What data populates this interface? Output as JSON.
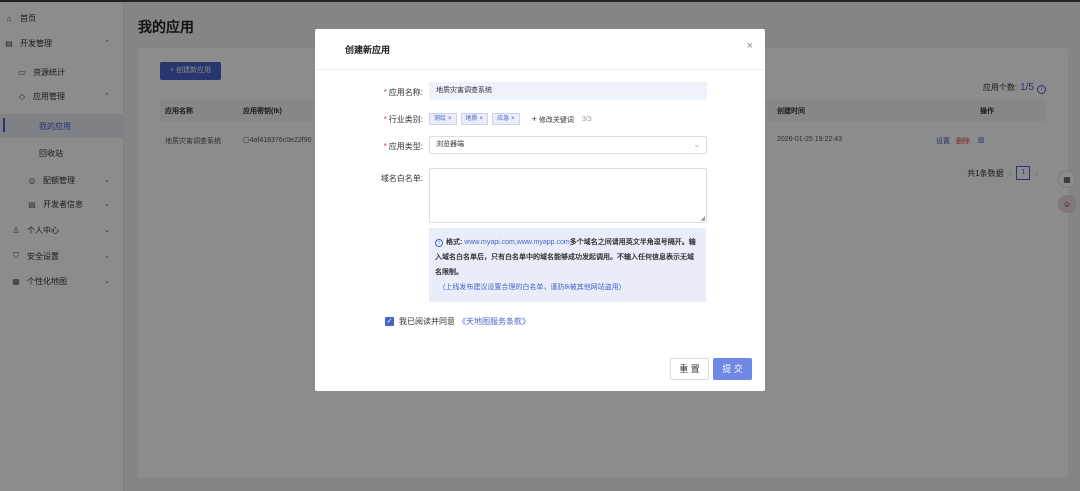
{
  "sidebar": {
    "items": [
      {
        "label": "首页",
        "icon": "home-icon",
        "glyph": "⌂"
      },
      {
        "label": "开发管理",
        "icon": "document-icon",
        "glyph": "▤",
        "chevron": "⌃"
      },
      {
        "label": "资源统计",
        "icon": "monitor-icon",
        "glyph": "▭"
      },
      {
        "label": "应用管理",
        "icon": "apps-icon",
        "glyph": "◇",
        "chevron": "⌃"
      },
      {
        "label": "我的应用"
      },
      {
        "label": "回收站"
      },
      {
        "label": "配额管理",
        "icon": "quota-icon",
        "glyph": "◎",
        "chevron": "⌄"
      },
      {
        "label": "开发者信息",
        "icon": "developer-icon",
        "glyph": "▤",
        "chevron": "⌄"
      },
      {
        "label": "个人中心",
        "icon": "user-icon",
        "glyph": "♙",
        "chevron": "⌄"
      },
      {
        "label": "安全设置",
        "icon": "shield-icon",
        "glyph": "⛉",
        "chevron": "⌄"
      },
      {
        "label": "个性化地图",
        "icon": "map-grid-icon",
        "glyph": "▦",
        "chevron": "⌄"
      }
    ]
  },
  "main": {
    "title": "我的应用",
    "create_button": "+ 创建新应用",
    "app_count_label": "应用个数:",
    "app_count_value": "1/5",
    "columns": {
      "name": "应用名称",
      "key": "应用密钥(tk)",
      "created": "创建时间",
      "ops": "操作"
    },
    "row": {
      "name": "地质灾害调查系统",
      "key": "▢4af418376c0e22f90",
      "created": "2026-01-25 19:22:43",
      "op_settings": "设置",
      "op_delete": "删除",
      "op_stats": "▥"
    },
    "pager": {
      "total": "共1条数据",
      "prev": "‹",
      "page": "1",
      "next": "›"
    }
  },
  "modal": {
    "title": "创建新应用",
    "close": "×",
    "name_label": "应用名称:",
    "name_value": "地质灾害调查系统",
    "industry_label": "行业类别:",
    "tags": [
      "测绘",
      "地质",
      "应急"
    ],
    "modify_button": "修改关键词",
    "tag_count": "3/3",
    "type_label": "应用类型:",
    "type_value": "浏览器端",
    "whitelist_label": "域名白名单:",
    "tip": {
      "format_label": "格式:",
      "domains": "www.myapi.com,www.myapp.com",
      "text_1": "多个域名之间请用英文半角逗号隔开。输入域名白名单后，只有白名单中的域名能够成功发起调用。不输入任何信息表示无域名限制。",
      "note": "(上线发布建议设置合理的白名单，谨防tk被其他网站盗用)"
    },
    "agree_text": "我已阅读并同意",
    "agree_link": "《天地图服务条款》",
    "reset_button": "重 置",
    "submit_button": "提 交"
  },
  "colors": {
    "accent": "#4a62c8",
    "submit": "#6f88e6",
    "overlay": "rgba(0,0,0,0.45)"
  }
}
